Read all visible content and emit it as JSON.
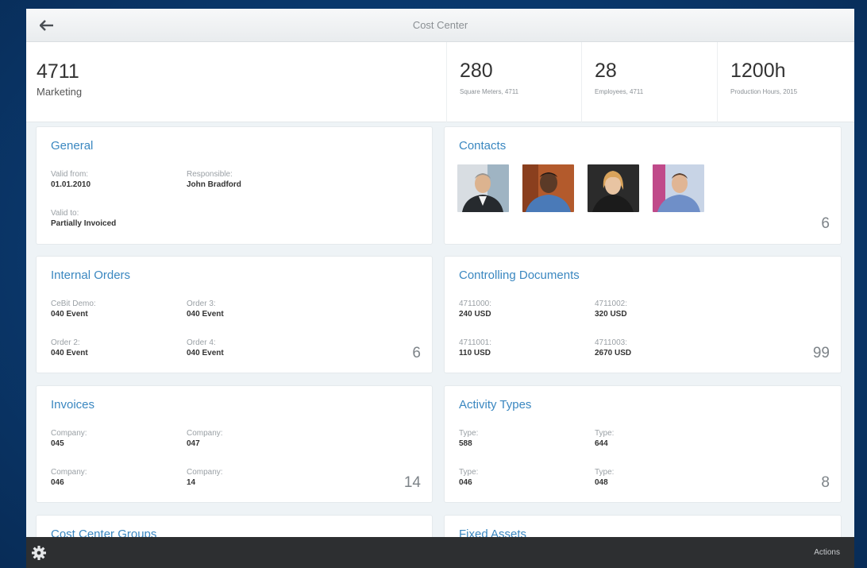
{
  "topbar": {
    "title": "Cost Center"
  },
  "header": {
    "id": "4711",
    "name": "Marketing",
    "kpis": [
      {
        "value": "280",
        "label": "Square Meters, 4711"
      },
      {
        "value": "28",
        "label": "Employees, 4711"
      },
      {
        "value": "1200h",
        "label": "Production Hours, 2015"
      }
    ]
  },
  "general": {
    "title": "General",
    "valid_from_label": "Valid from:",
    "valid_from_value": "01.01.2010",
    "responsible_label": "Responsible:",
    "responsible_value": "John Bradford",
    "valid_to_label": "Valid to:",
    "valid_to_value": "Partially Invoiced"
  },
  "contacts": {
    "title": "Contacts",
    "count": "6"
  },
  "internal_orders": {
    "title": "Internal Orders",
    "count": "6",
    "items": [
      {
        "label": "CeBit Demo:",
        "value": "040 Event"
      },
      {
        "label": "Order 3:",
        "value": "040 Event"
      },
      {
        "label": "Order 2:",
        "value": "040 Event"
      },
      {
        "label": "Order 4:",
        "value": "040 Event"
      }
    ]
  },
  "controlling_documents": {
    "title": "Controlling Documents",
    "count": "99",
    "items": [
      {
        "label": "4711000:",
        "value": "240 USD"
      },
      {
        "label": "4711002:",
        "value": "320 USD"
      },
      {
        "label": "4711001:",
        "value": "110 USD"
      },
      {
        "label": "4711003:",
        "value": "2670 USD"
      }
    ]
  },
  "invoices": {
    "title": "Invoices",
    "count": "14",
    "items": [
      {
        "label": "Company:",
        "value": "045"
      },
      {
        "label": "Company:",
        "value": "047"
      },
      {
        "label": "Company:",
        "value": "046"
      },
      {
        "label": "Company:",
        "value": "14"
      }
    ]
  },
  "activity_types": {
    "title": "Activity Types",
    "count": "8",
    "items": [
      {
        "label": "Type:",
        "value": "588"
      },
      {
        "label": "Type:",
        "value": "644"
      },
      {
        "label": "Type:",
        "value": "046"
      },
      {
        "label": "Type:",
        "value": "048"
      }
    ]
  },
  "cost_center_groups": {
    "title": "Cost Center Groups"
  },
  "fixed_assets": {
    "title": "Fixed Assets"
  },
  "bottombar": {
    "actions_label": "Actions"
  },
  "icons": {
    "back": "arrow-left-icon",
    "settings": "gear-icon"
  },
  "colors": {
    "accent": "#3a87c0",
    "background": "#0b3c73",
    "footer": "#2d2f31"
  }
}
